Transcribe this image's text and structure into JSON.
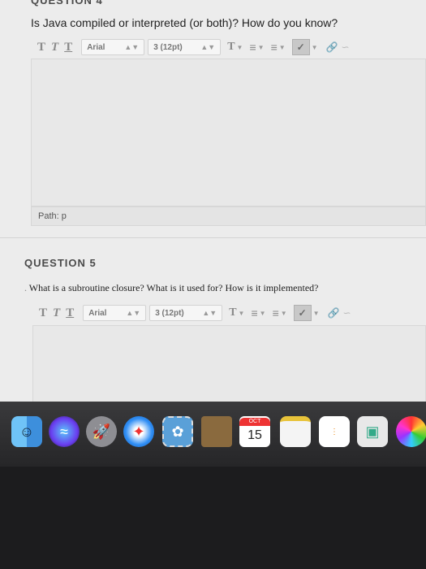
{
  "question4": {
    "title": "QUESTION 4",
    "text": "Is Java compiled or interpreted (or both)? How do you know?",
    "toolbar": {
      "bold": "T",
      "italic": "T",
      "underline": "T",
      "font": "Arial",
      "size": "3 (12pt)",
      "icons": [
        "text-color-icon",
        "bullet-list-icon",
        "numbered-list-icon",
        "spellcheck-icon",
        "link-icon",
        "unlink-icon"
      ]
    },
    "path": "Path: p"
  },
  "question5": {
    "title": "QUESTION 5",
    "text": "What is a subroutine closure? What is it used for? How is it implemented?",
    "toolbar": {
      "bold": "T",
      "italic": "T",
      "underline": "T",
      "font": "Arial",
      "size": "3 (12pt)"
    }
  },
  "dock": {
    "calendar_month": "OCT",
    "calendar_day": "15",
    "apps": [
      "finder",
      "siri",
      "launchpad",
      "safari",
      "photos-mail",
      "notes-folder",
      "calendar",
      "textedit",
      "reminders",
      "preview",
      "photos"
    ]
  }
}
